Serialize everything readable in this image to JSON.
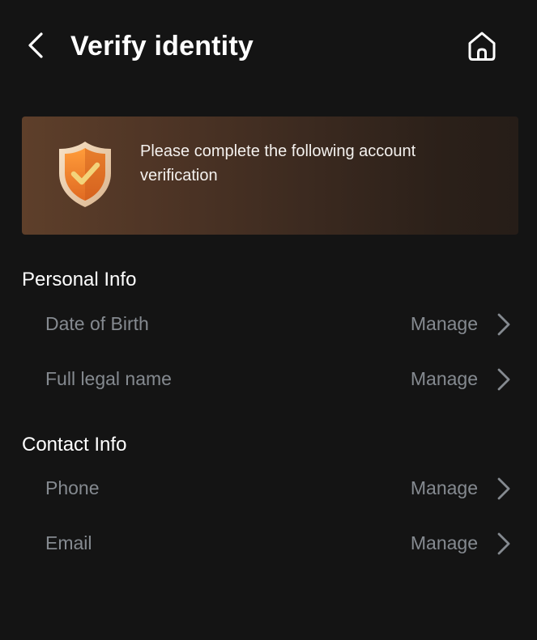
{
  "header": {
    "title": "Verify identity",
    "back_icon": "chevron-left-icon",
    "home_icon": "home-icon"
  },
  "banner": {
    "message": "Please complete the following account verification",
    "icon": "shield-check-icon"
  },
  "sections": [
    {
      "title": "Personal Info",
      "items": [
        {
          "label": "Date of Birth",
          "action": "Manage"
        },
        {
          "label": "Full legal name",
          "action": "Manage"
        }
      ]
    },
    {
      "title": "Contact Info",
      "items": [
        {
          "label": "Phone",
          "action": "Manage"
        },
        {
          "label": "Email",
          "action": "Manage"
        }
      ]
    }
  ],
  "colors": {
    "background": "#141414",
    "muted_text": "#858a90",
    "shield_orange": "#f08a2c",
    "check_yellow": "#f3d37a"
  }
}
